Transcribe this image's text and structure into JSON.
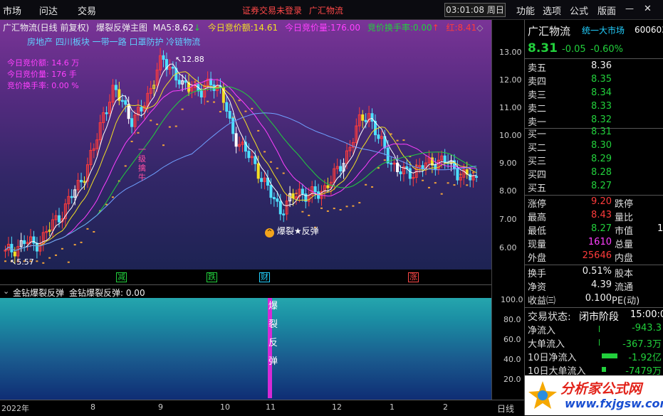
{
  "menu": [
    "市场",
    "问达",
    "交易"
  ],
  "status_warning": "证券交易未登录",
  "status_stock": "广汇物流",
  "clock": "03:01:08 周日",
  "right_menu": [
    "功能",
    "选项",
    "公式",
    "版面"
  ],
  "chart_header": {
    "stock": "广汇物流(日线 前复权)",
    "formula": "爆裂反弹主图",
    "ma5_label": "MA5:",
    "ma5_val": "8.62",
    "amount_label": "今日竞价额:",
    "amount_val": "14.61",
    "volume_label": "今日竞价量:",
    "volume_val": "176.00",
    "turnover_label": "竞价换手率:",
    "turnover_val": "0.00",
    "red_label": "红:",
    "red_val": "8.41"
  },
  "sectors": "房地产 四川板块 一带一路 口罩防护 冷链物流",
  "auction_notes": [
    {
      "label": "今日竞价额:",
      "value": "14.6",
      "unit": "万"
    },
    {
      "label": "今日竞价量:",
      "value": "176",
      "unit": "手"
    },
    {
      "label": "竞价换手率:",
      "value": "0.00",
      "unit": "%"
    }
  ],
  "annotations": {
    "high": "12.88",
    "low": "5.57",
    "signal": "爆裂★反弹",
    "bull_chars": [
      "一",
      "级",
      "擒",
      "牛"
    ]
  },
  "y_ticks": [
    "13.00",
    "12.00",
    "11.00",
    "10.00",
    "9.00",
    "8.00",
    "7.00",
    "6.00"
  ],
  "markers": [
    {
      "text": "减",
      "color": "#22d03c"
    },
    {
      "text": "跌",
      "color": "#22d03c"
    },
    {
      "text": "财",
      "color": "#22d0ff"
    },
    {
      "text": "涨",
      "color": "#ff4848"
    }
  ],
  "indicator": {
    "name": "金钻爆裂反弹",
    "line": "金钻爆裂反弹: 0.00",
    "ticks": [
      "100.0",
      "80.0",
      "60.0",
      "40.0",
      "20.0"
    ],
    "signal_chars": [
      "爆",
      "裂",
      "反",
      "弹"
    ]
  },
  "x_ticks": [
    "2022年",
    "8",
    "9",
    "10",
    "11",
    "12",
    "1",
    "2"
  ],
  "x_right": "日线",
  "panel": {
    "name": "广汇物流",
    "market": "统一大市场",
    "code": "600603",
    "price": "8.31",
    "change": "-0.05",
    "pct": "-0.60%",
    "asks": [
      {
        "label": "卖五",
        "price": "8.36",
        "color": "white"
      },
      {
        "label": "卖四",
        "price": "8.35",
        "color": "green"
      },
      {
        "label": "卖三",
        "price": "8.34",
        "color": "green"
      },
      {
        "label": "卖二",
        "price": "8.33",
        "color": "green"
      },
      {
        "label": "卖一",
        "price": "8.32",
        "color": "green"
      }
    ],
    "bids": [
      {
        "label": "买一",
        "price": "8.31",
        "color": "green"
      },
      {
        "label": "买二",
        "price": "8.30",
        "color": "green"
      },
      {
        "label": "买三",
        "price": "8.29",
        "color": "green"
      },
      {
        "label": "买四",
        "price": "8.28",
        "color": "green"
      },
      {
        "label": "买五",
        "price": "8.27",
        "color": "green"
      }
    ],
    "stats": [
      {
        "l1": "涨停",
        "v1": "9.20",
        "c1": "red",
        "l2": "跌停"
      },
      {
        "l1": "最高",
        "v1": "8.43",
        "c1": "red",
        "l2": "量比"
      },
      {
        "l1": "最低",
        "v1": "8.27",
        "c1": "green",
        "l2": "市值",
        "v2": "1"
      },
      {
        "l1": "现量",
        "v1": "1610",
        "c1": "mag",
        "l2": "总量"
      },
      {
        "l1": "外盘",
        "v1": "25646",
        "c1": "red",
        "l2": "内盘"
      }
    ],
    "stats2": [
      {
        "l1": "换手",
        "v1": "0.51%",
        "c1": "white",
        "l2": "股本"
      },
      {
        "l1": "净资",
        "v1": "4.39",
        "c1": "white",
        "l2": "流通"
      },
      {
        "l1": "收益㈢",
        "v1": "0.100",
        "c1": "white",
        "l2": "PE(动)"
      }
    ],
    "trade_state_label": "交易状态:",
    "trade_state": "闭市阶段",
    "trade_time": "15:00:0",
    "flows": [
      {
        "label": "净流入",
        "value": "-943.3"
      },
      {
        "label": "大单流入",
        "value": "-367.3万"
      },
      {
        "label": "10日净流入",
        "value": "-1.92亿"
      },
      {
        "label": "10日大单流入",
        "value": "-7479万"
      }
    ],
    "logo_text": "分析家公式网",
    "logo_url": "www.fxjgsw.com"
  },
  "chart_data": {
    "type": "candlestick",
    "title": "广汇物流(日线 前复权)",
    "ylim": [
      5.5,
      13.5
    ],
    "x_ticks": [
      "2022年",
      "8",
      "9",
      "10",
      "11",
      "12",
      "1",
      "2"
    ],
    "annotated_high": 12.88,
    "annotated_low": 5.57,
    "close_series": [
      5.8,
      6.0,
      6.2,
      6.1,
      6.4,
      6.9,
      7.3,
      7.9,
      8.5,
      9.3,
      10.6,
      11.3,
      11.0,
      10.2,
      10.8,
      11.6,
      12.4,
      12.1,
      11.4,
      11.6,
      11.2,
      11.7,
      11.3,
      10.0,
      9.5,
      9.0,
      8.5,
      7.8,
      7.3,
      7.6,
      7.9,
      7.8,
      7.8,
      8.3,
      8.6,
      9.4,
      10.2,
      10.6,
      9.7,
      9.1,
      8.6,
      8.5,
      8.7,
      8.8,
      9.0,
      8.9,
      8.6,
      8.4,
      8.31
    ]
  }
}
